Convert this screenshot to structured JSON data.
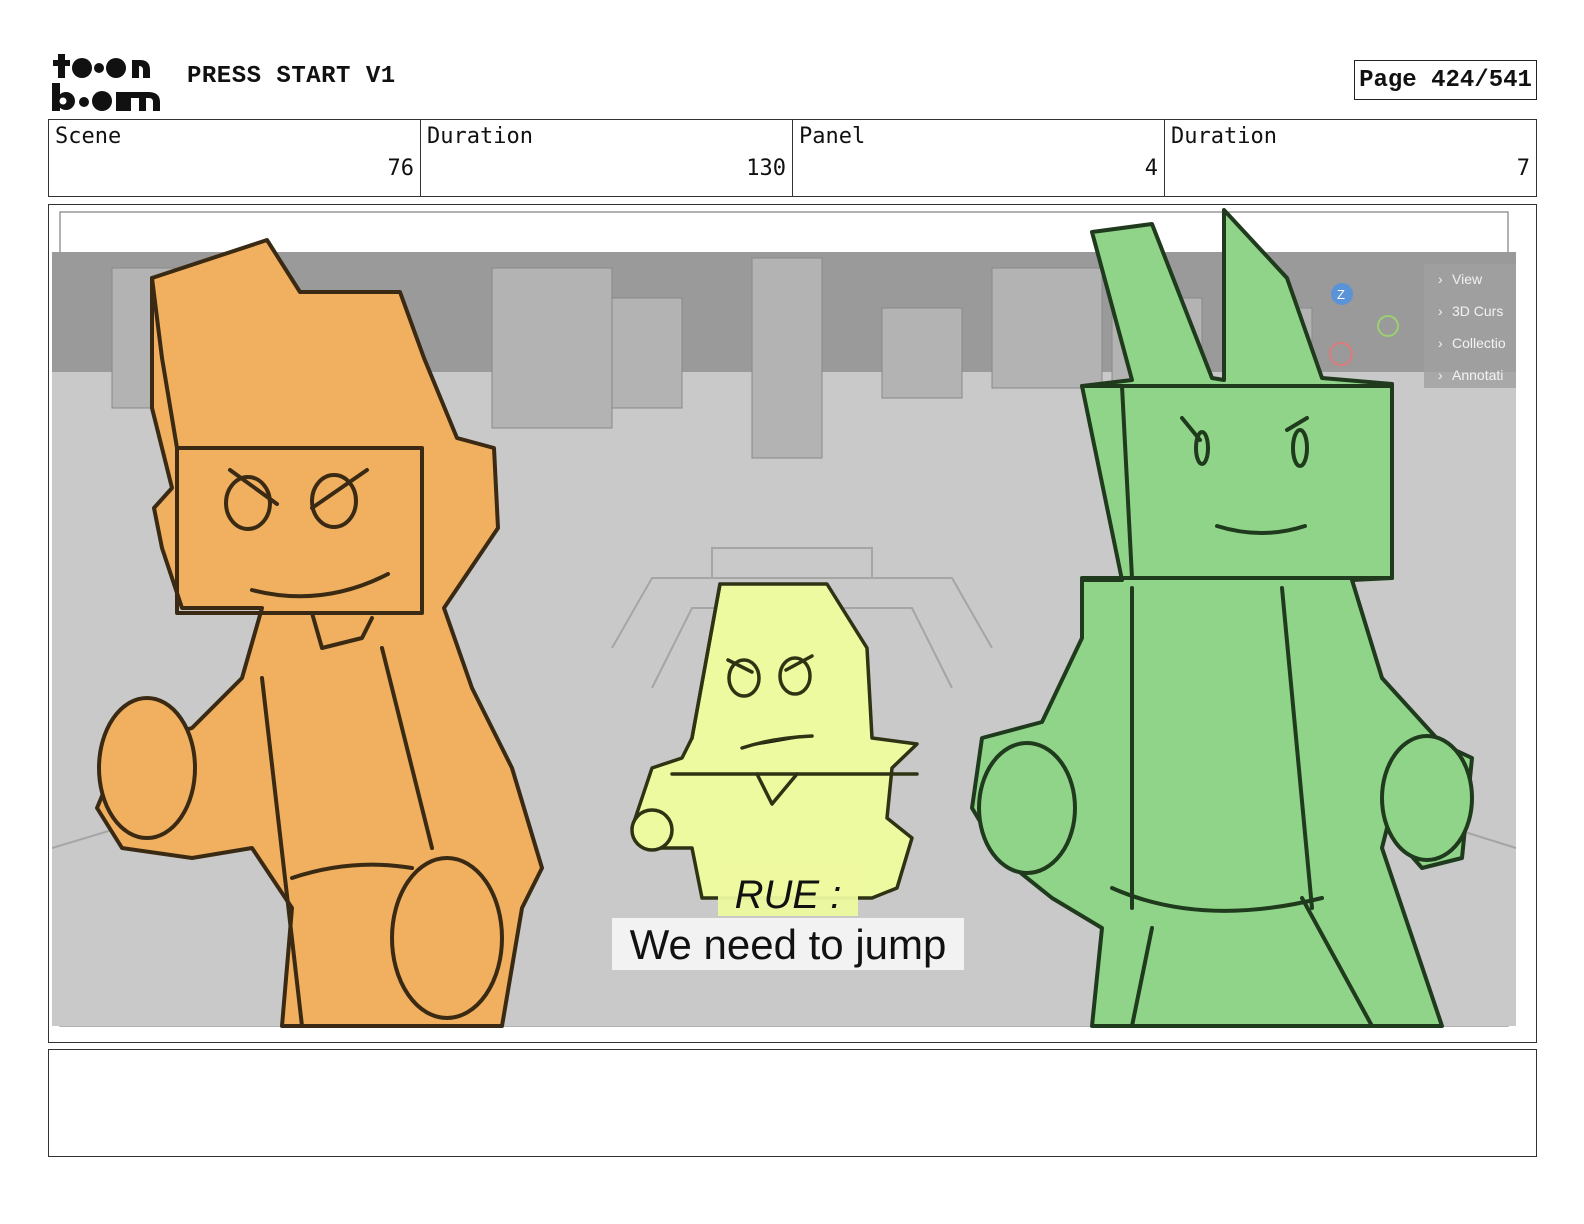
{
  "header": {
    "logo_text": "toon boom",
    "project_title": "PRESS START V1",
    "page_label": "Page 424/541"
  },
  "info": {
    "scene_label": "Scene",
    "scene_value": "76",
    "scene_duration_label": "Duration",
    "scene_duration_value": "130",
    "panel_label": "Panel",
    "panel_value": "4",
    "panel_duration_label": "Duration",
    "panel_duration_value": "7"
  },
  "panel": {
    "viewport_menu": [
      "View",
      "3D Curs",
      "Collectio",
      "Annotati"
    ],
    "gizmo_axis": "Z",
    "caption_speaker": "RUE :",
    "caption_line": "We need to jump"
  },
  "notes": {
    "text": ""
  },
  "colors": {
    "orange_character": "#f0b060",
    "yellow_character": "#eefaa0",
    "green_character": "#8fd488",
    "background_gray": "#c8c8c8"
  }
}
